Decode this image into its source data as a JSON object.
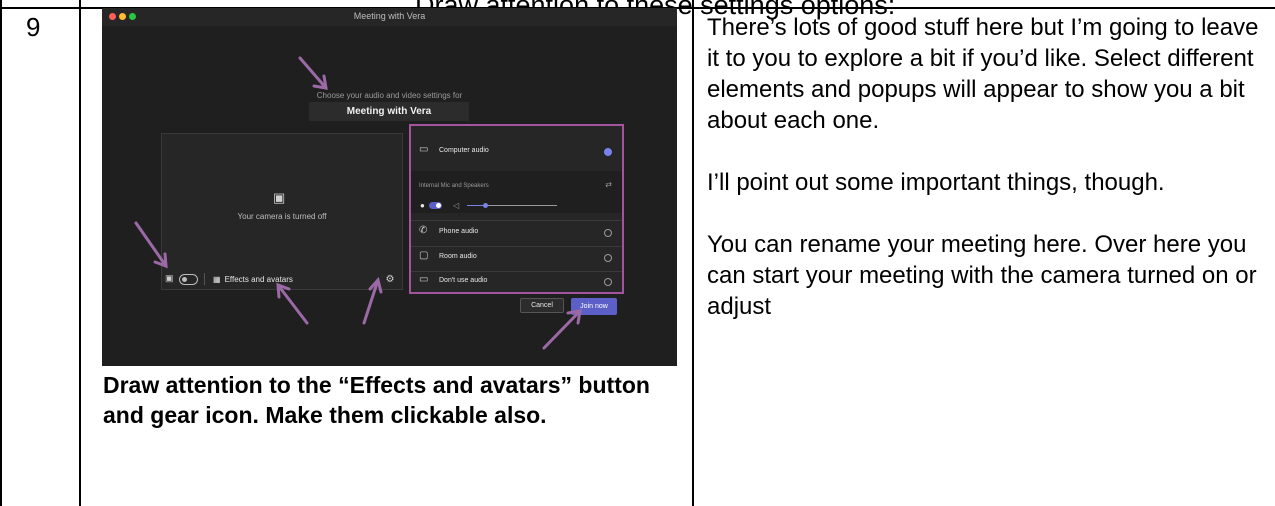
{
  "top_clip_text": "Draw attention to these settings options:",
  "row_number": "9",
  "screenshot": {
    "window_title": "Meeting with Vera",
    "choose_text": "Choose your audio and video settings for",
    "meeting_name": "Meeting with Vera",
    "camera_off_text": "Your camera is turned off",
    "effects_label": "Effects and avatars",
    "audio_options": {
      "computer_audio": "Computer audio",
      "device_label": "Internal Mic and Speakers",
      "phone_audio": "Phone audio",
      "room_audio": "Room audio",
      "dont_use_audio": "Don't use audio"
    },
    "cancel_label": "Cancel",
    "join_label": "Join now",
    "colors": {
      "accent": "#5b5fc7",
      "highlight": "#a2549c",
      "arrow": "#9b6aa6"
    }
  },
  "caption": "Draw attention to the “Effects and avatars” button and gear icon. Make them clickable also.",
  "narration": [
    "There’s lots of good stuff here but I’m going to leave it to you to explore a bit if you’d like. Select different elements and popups will appear to show you a bit about each one.",
    "I’ll point out some important things, though.",
    "You can rename your meeting here. Over here you can start your meeting with the camera turned on or adjust"
  ]
}
